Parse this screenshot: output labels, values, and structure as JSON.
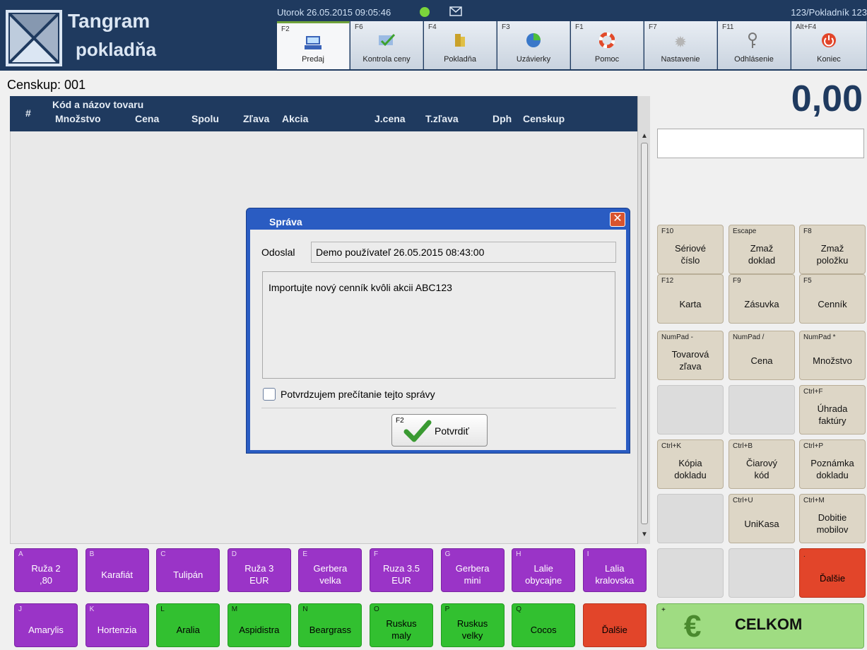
{
  "header": {
    "app_title": "Tangram",
    "app_subtitle": "pokladňa",
    "datetime": "Utorok 26.05.2015 09:05:46",
    "user": "123/Pokladník 123",
    "status_color": "#7bd43b",
    "fkeys": [
      {
        "key": "F2",
        "label": "Predaj",
        "icon": "cash-register-icon"
      },
      {
        "key": "F6",
        "label": "Kontrola ceny",
        "icon": "price-check-icon"
      },
      {
        "key": "F4",
        "label": "Pokladňa",
        "icon": "drawer-icon"
      },
      {
        "key": "F3",
        "label": "Uzávierky",
        "icon": "pie-chart-icon"
      },
      {
        "key": "F1",
        "label": "Pomoc",
        "icon": "lifebuoy-icon"
      },
      {
        "key": "F7",
        "label": "Nastavenie",
        "icon": "gear-icon"
      },
      {
        "key": "F11",
        "label": "Odhlásenie",
        "icon": "keys-icon"
      },
      {
        "key": "Alt+F4",
        "label": "Koniec",
        "icon": "power-icon"
      }
    ]
  },
  "main": {
    "censkup": "Censkup: 001",
    "total": "0,00",
    "grid": {
      "hash": "#",
      "line1": "Kód a názov tovaru",
      "columns": [
        "Množstvo",
        "Cena",
        "Spolu",
        "Zľava",
        "Akcia",
        "J.cena",
        "T.zľava",
        "Dph",
        "Censkup"
      ]
    }
  },
  "panel": [
    {
      "key": "F10",
      "label": "Sériové\nčíslo"
    },
    {
      "key": "Escape",
      "label": "Zmaž\ndoklad"
    },
    {
      "key": "F8",
      "label": "Zmaž\npoložku"
    },
    {
      "key": "F12",
      "label": "Karta"
    },
    {
      "key": "F9",
      "label": "Zásuvka"
    },
    {
      "key": "F5",
      "label": "Cenník"
    },
    {
      "key": "NumPad -",
      "label": "Tovarová\nzľava"
    },
    {
      "key": "NumPad /",
      "label": "Cena"
    },
    {
      "key": "NumPad *",
      "label": "Množstvo"
    },
    {
      "key": "",
      "label": ""
    },
    {
      "key": "",
      "label": ""
    },
    {
      "key": "Ctrl+F",
      "label": "Úhrada\nfaktúry"
    },
    {
      "key": "Ctrl+K",
      "label": "Kópia\ndokladu"
    },
    {
      "key": "Ctrl+B",
      "label": "Čiarový\nkód"
    },
    {
      "key": "Ctrl+P",
      "label": "Poznámka\ndokladu"
    },
    {
      "key": "",
      "label": ""
    },
    {
      "key": "Ctrl+U",
      "label": "UniKasa"
    },
    {
      "key": "Ctrl+M",
      "label": "Dobitie\nmobilov"
    },
    {
      "key": "",
      "label": ""
    },
    {
      "key": "",
      "label": ""
    },
    {
      "key": ".",
      "label": "Ďalšie"
    }
  ],
  "quick_row1": [
    {
      "key": "A",
      "label": "Ruža 2\n,80"
    },
    {
      "key": "B",
      "label": "Karafiát"
    },
    {
      "key": "C",
      "label": "Tulipán"
    },
    {
      "key": "D",
      "label": "Ruža 3\nEUR"
    },
    {
      "key": "E",
      "label": "Gerbera\nvelka"
    },
    {
      "key": "F",
      "label": "Ruza 3.5\nEUR"
    },
    {
      "key": "G",
      "label": "Gerbera\nmini"
    },
    {
      "key": "H",
      "label": "Lalie\nobycajne"
    },
    {
      "key": "I",
      "label": "Lalia\nkralovska"
    }
  ],
  "quick_row2": [
    {
      "key": "J",
      "label": "Amarylis"
    },
    {
      "key": "K",
      "label": "Hortenzia"
    },
    {
      "key": "L",
      "label": "Aralia"
    },
    {
      "key": "M",
      "label": "Aspidistra"
    },
    {
      "key": "N",
      "label": "Beargrass"
    },
    {
      "key": "O",
      "label": "Ruskus\nmaly"
    },
    {
      "key": "P",
      "label": "Ruskus\nvelky"
    },
    {
      "key": "Q",
      "label": "Cocos"
    },
    {
      "key": "",
      "label": "Ďalšie"
    }
  ],
  "celkom": {
    "key": "+",
    "symbol": "€",
    "label": "CELKOM"
  },
  "dialog": {
    "title": "Správa",
    "sender_label": "Odoslal",
    "sender_value": "Demo používateľ 26.05.2015 08:43:00",
    "message": "Importujte nový cenník kvôli akcii ABC123",
    "confirm_label": "Potvrdzujem prečítanie tejto správy",
    "confirm_checked": false,
    "ok_key": "F2",
    "ok_label": "Potvrdiť"
  }
}
